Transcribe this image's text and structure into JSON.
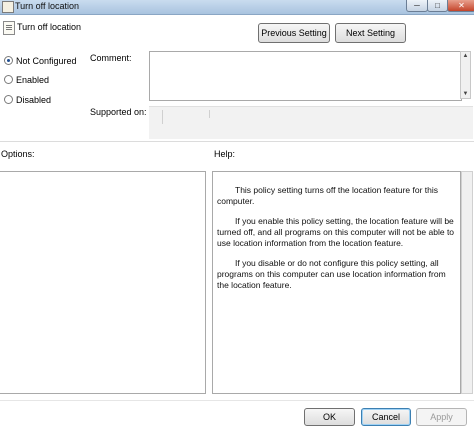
{
  "window": {
    "title": "Turn off location",
    "controls": {
      "minimize": "─",
      "maximize": "□",
      "close": "✕"
    }
  },
  "policy": {
    "name": "Turn off location",
    "icon": "policy-document-icon"
  },
  "nav": {
    "previous_label": "Previous Setting",
    "next_label": "Next Setting"
  },
  "state": {
    "options": [
      {
        "label": "Not Configured",
        "checked": true
      },
      {
        "label": "Enabled",
        "checked": false
      },
      {
        "label": "Disabled",
        "checked": false
      }
    ]
  },
  "comment": {
    "label": "Comment:",
    "value": ""
  },
  "supported": {
    "label": "Supported on:",
    "value": ""
  },
  "sections": {
    "options_label": "Options:",
    "help_label": "Help:"
  },
  "help": {
    "paragraphs": [
      "This policy setting turns off the location feature for this computer.",
      "If you enable this policy setting, the location feature will be turned off, and all programs on this computer will not be able to use location information from the location feature.",
      "If you disable or do not configure this policy setting, all programs on this computer can use location information from the location feature."
    ]
  },
  "footer": {
    "ok_label": "OK",
    "cancel_label": "Cancel",
    "apply_label": "Apply"
  },
  "colors": {
    "titlebar": "#a9c3df",
    "close": "#c4442a",
    "radio_dot": "#1f4d90",
    "focus_border": "#3c7fb1"
  }
}
